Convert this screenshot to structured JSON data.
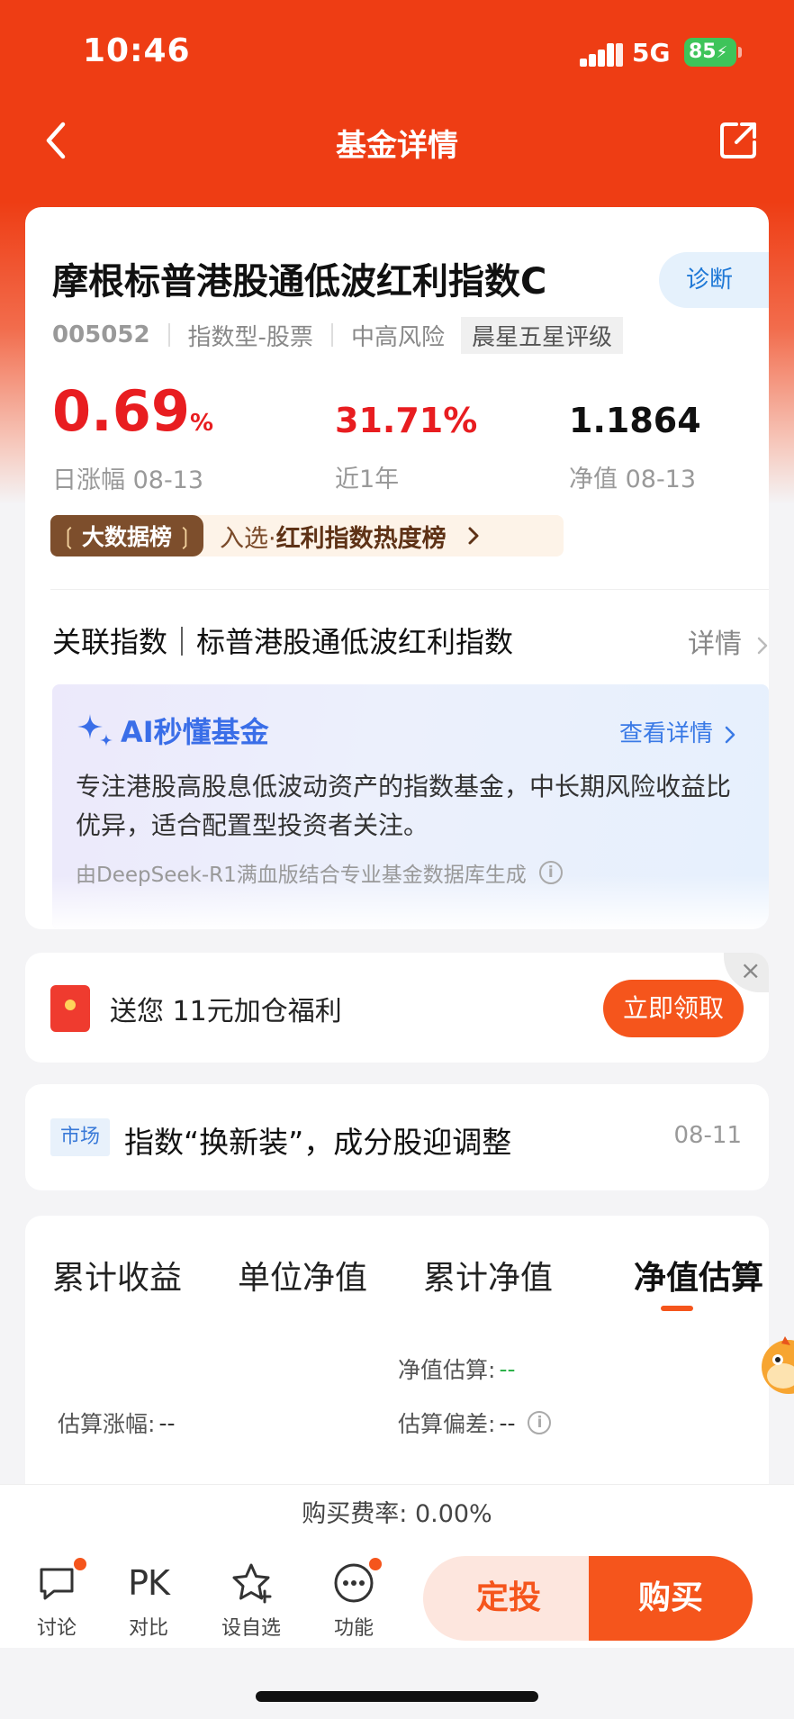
{
  "status_bar": {
    "time": "10:46",
    "network": "5G",
    "battery": "85"
  },
  "nav": {
    "title": "基金详情",
    "back_icon": "chevron-left-icon",
    "share_icon": "share-icon"
  },
  "fund": {
    "name": "摩根标普港股通低波红利指数C",
    "diagnose_label": "诊断",
    "code": "005052",
    "type": "指数型-股票",
    "risk": "中高风险",
    "rating": "晨星五星评级",
    "daily_change": {
      "value": "0.69",
      "unit": "%",
      "label": "日涨幅 08-13"
    },
    "one_year": {
      "value": "31.71%",
      "label": "近1年"
    },
    "nav_value": {
      "value": "1.1864",
      "label": "净值 08-13"
    },
    "rank_badge": "大数据榜",
    "rank_text_prefix": "入选·",
    "rank_text": "红利指数热度榜",
    "related_index": "关联指数｜标普港股通低波红利指数",
    "related_detail": "详情"
  },
  "ai": {
    "title": "AI秒懂基金",
    "more": "查看详情",
    "description": "专注港股高股息低波动资产的指数基金，中长期风险收益比优异，适合配置型投资者关注。",
    "source": "由DeepSeek-R1满血版结合专业基金数据库生成"
  },
  "promo": {
    "text": "送您 11元加仓福利",
    "button": "立即领取",
    "close": "×"
  },
  "news": {
    "tag": "市场",
    "title": "指数“换新装”，成分股迎调整",
    "date": "08-11"
  },
  "chart_tabs": [
    "累计收益",
    "单位净值",
    "累计净值",
    "净值估算"
  ],
  "active_tab": 3,
  "estimate": {
    "nav_label": "净值估算:",
    "nav_value": "--",
    "change_label": "估算涨幅:",
    "change_value": "--",
    "deviation_label": "估算偏差:",
    "deviation_value": "--"
  },
  "fee": "购买费率: 0.00%",
  "bottom_tools": [
    {
      "label": "讨论",
      "icon": "chat-icon"
    },
    {
      "label": "对比",
      "icon": "pk-icon"
    },
    {
      "label": "设自选",
      "icon": "star-icon"
    },
    {
      "label": "功能",
      "icon": "more-icon"
    }
  ],
  "buttons": {
    "sip": "定投",
    "buy": "购买"
  },
  "colors": {
    "brand": "#ee3d14",
    "accent": "#f5551c",
    "rise": "#e81d20",
    "link": "#3a7ae6"
  }
}
